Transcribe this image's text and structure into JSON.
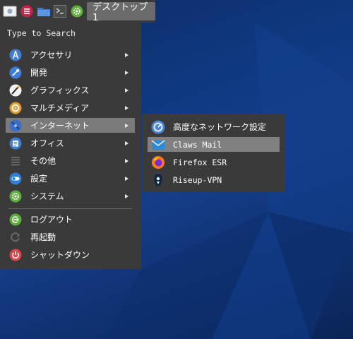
{
  "panel": {
    "desktop_label": "デスクトップ1",
    "launchers": [
      "start-menu-icon",
      "app-menu-icon",
      "file-manager-icon",
      "terminal-icon",
      "settings-icon"
    ]
  },
  "menu": {
    "search_placeholder": "Type to Search",
    "categories": [
      {
        "label": "アクセサリ",
        "icon": "accessories-icon",
        "submenu": true
      },
      {
        "label": "開発",
        "icon": "development-icon",
        "submenu": true
      },
      {
        "label": "グラフィックス",
        "icon": "graphics-icon",
        "submenu": true
      },
      {
        "label": "マルチメディア",
        "icon": "multimedia-icon",
        "submenu": true
      },
      {
        "label": "インターネット",
        "icon": "internet-icon",
        "submenu": true,
        "selected": true
      },
      {
        "label": "オフィス",
        "icon": "office-icon",
        "submenu": true
      },
      {
        "label": "その他",
        "icon": "other-icon",
        "submenu": true
      },
      {
        "label": "設定",
        "icon": "preferences-icon",
        "submenu": true
      },
      {
        "label": "システム",
        "icon": "system-icon",
        "submenu": true
      }
    ],
    "actions": [
      {
        "label": "ログアウト",
        "icon": "logout-icon"
      },
      {
        "label": "再起動",
        "icon": "reboot-icon"
      },
      {
        "label": "シャットダウン",
        "icon": "shutdown-icon"
      }
    ]
  },
  "submenu": {
    "items": [
      {
        "label": "高度なネットワーク設定",
        "icon": "network-settings-icon"
      },
      {
        "label": "Claws Mail",
        "icon": "mail-icon",
        "selected": true
      },
      {
        "label": "Firefox ESR",
        "icon": "firefox-icon"
      },
      {
        "label": "Riseup-VPN",
        "icon": "vpn-icon"
      }
    ]
  },
  "colors": {
    "panel_bg": "#3a3a3a",
    "selected_bg": "#7a7a7a",
    "desktop_bg": "#0f3a82"
  }
}
